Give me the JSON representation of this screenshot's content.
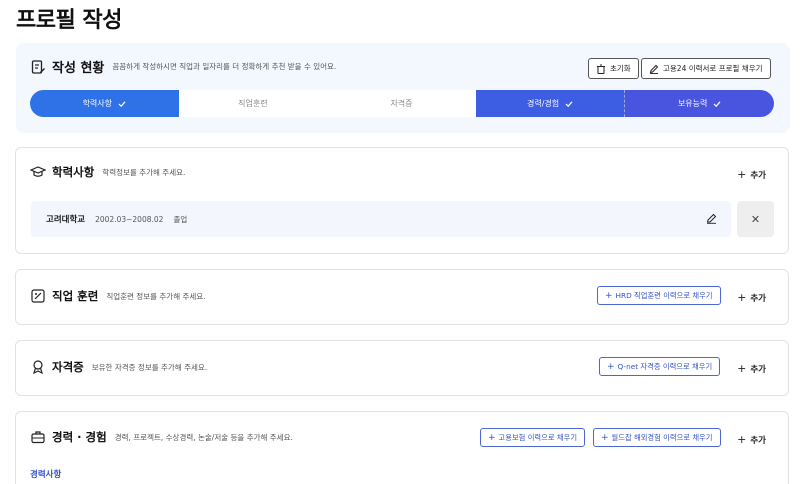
{
  "page": {
    "title": "프로필 작성"
  },
  "status": {
    "title": "작성 현황",
    "description": "꼼꼼하게 작성하시면 직업과 일자리를 더 정확하게 추천 받을 수 있어요.",
    "reset_label": "초기화",
    "fill_label": "고용24 이력서로 프로필 채우기",
    "steps": [
      {
        "label": "학력사항",
        "done": true
      },
      {
        "label": "직업훈련",
        "done": false
      },
      {
        "label": "자격증",
        "done": false
      },
      {
        "label": "경력/경험",
        "done": true
      },
      {
        "label": "보유능력",
        "done": true
      }
    ]
  },
  "education": {
    "title": "학력사항",
    "description": "학력정보를 추가해 주세요.",
    "add_label": "추가",
    "entry": {
      "school": "고려대학교",
      "period": "2002.03~2008.02",
      "status": "졸업"
    }
  },
  "training": {
    "title": "직업 훈련",
    "description": "직업훈련 정보를 추가해 주세요.",
    "link_label": "HRD 직업훈련 이력으로 채우기",
    "add_label": "추가"
  },
  "certificate": {
    "title": "자격증",
    "description": "보유한 자격증 정보를 추가해 주세요.",
    "link_label": "Q-net 자격증 이력으로 채우기",
    "add_label": "추가"
  },
  "career": {
    "title": "경력 · 경험",
    "description": "경력, 프로젝트, 수상경력, 논술/저술 등을 추가해 주세요.",
    "link1_label": "고용보험 이력으로 채우기",
    "link2_label": "월드잡 해외경험 이력으로 채우기",
    "add_label": "추가",
    "sub_label": "경력사항"
  },
  "colors": {
    "primary": "#2f72e8",
    "accent": "#3553c8",
    "card_bg": "#f3f7fe"
  }
}
